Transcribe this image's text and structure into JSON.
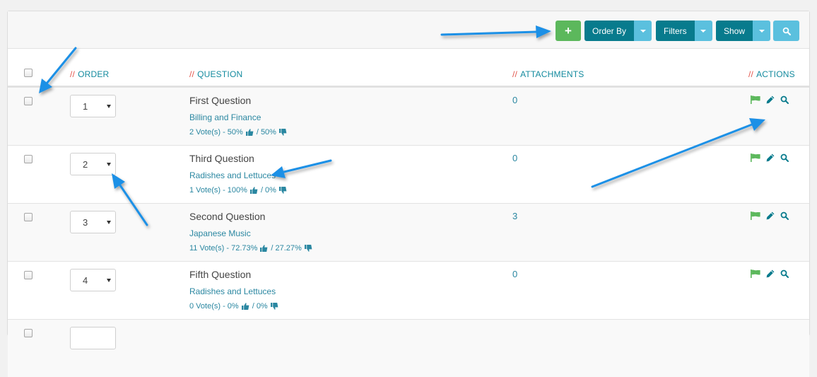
{
  "toolbar": {
    "add_symbol": "+",
    "order_by_label": "Order By",
    "filters_label": "Filters",
    "show_label": "Show"
  },
  "table": {
    "slash": "//",
    "headers": {
      "order": "ORDER",
      "question": "QUESTION",
      "attachments": "ATTACHMENTS",
      "actions": "ACTIONS"
    },
    "rows": [
      {
        "order": "1",
        "title": "First Question",
        "category": "Billing and Finance",
        "votes": "2 Vote(s) - 50%",
        "sep": "/ 50%",
        "attachments": "0"
      },
      {
        "order": "2",
        "title": "Third Question",
        "category": "Radishes and Lettuces",
        "votes": "1 Vote(s) - 100%",
        "sep": "/ 0%",
        "attachments": "0"
      },
      {
        "order": "3",
        "title": "Second Question",
        "category": "Japanese Music",
        "votes": "11 Vote(s) - 72.73%",
        "sep": "/ 27.27%",
        "attachments": "3"
      },
      {
        "order": "4",
        "title": "Fifth Question",
        "category": "Radishes and Lettuces",
        "votes": "0 Vote(s) - 0%",
        "sep": "/ 0%",
        "attachments": "0"
      }
    ]
  },
  "colors": {
    "primary": "#087b8d",
    "info": "#5bc0de",
    "success": "#5cb85c",
    "link": "#2a87a1",
    "accent_slash": "#e2534a",
    "annotation_arrow": "#1e90e6"
  },
  "icons": {
    "add": "plus-icon",
    "search": "search-icon",
    "flag": "flag-icon",
    "edit": "pencil-icon",
    "view": "search-icon",
    "up": "thumbs-up-icon",
    "down": "thumbs-down-icon"
  }
}
